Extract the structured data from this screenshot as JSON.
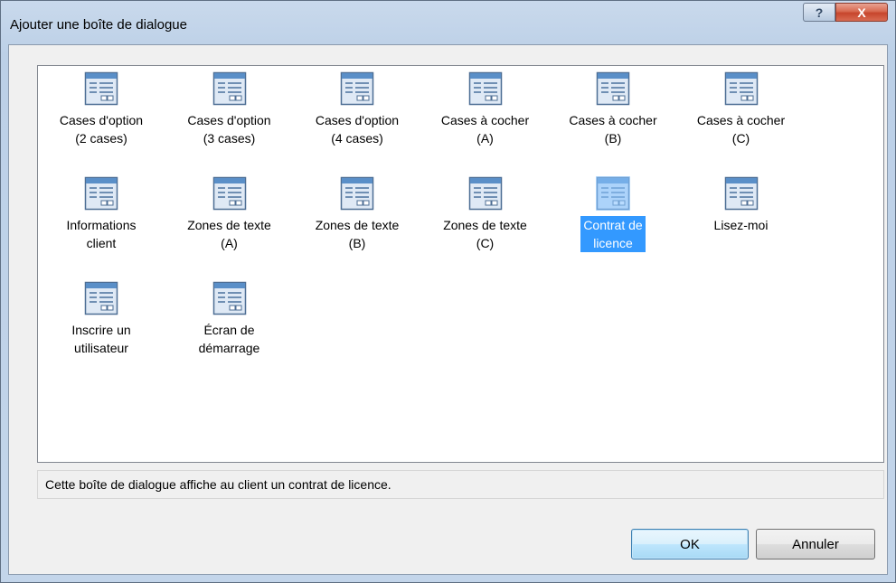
{
  "window": {
    "title": "Ajouter une boîte de dialogue",
    "help_label": "?",
    "close_label": "X"
  },
  "templates": [
    {
      "label": "Cases d'option\n(2 cases)",
      "name": "template-cases-option-2",
      "selected": false
    },
    {
      "label": "Cases d'option\n(3 cases)",
      "name": "template-cases-option-3",
      "selected": false
    },
    {
      "label": "Cases d'option\n(4 cases)",
      "name": "template-cases-option-4",
      "selected": false
    },
    {
      "label": "Cases à cocher\n(A)",
      "name": "template-cases-cocher-a",
      "selected": false
    },
    {
      "label": "Cases à cocher\n(B)",
      "name": "template-cases-cocher-b",
      "selected": false
    },
    {
      "label": "Cases à cocher\n(C)",
      "name": "template-cases-cocher-c",
      "selected": false
    },
    {
      "label": "Informations\nclient",
      "name": "template-informations-client",
      "selected": false
    },
    {
      "label": "Zones de texte\n(A)",
      "name": "template-zones-texte-a",
      "selected": false
    },
    {
      "label": "Zones de texte\n(B)",
      "name": "template-zones-texte-b",
      "selected": false
    },
    {
      "label": "Zones de texte\n(C)",
      "name": "template-zones-texte-c",
      "selected": false
    },
    {
      "label": "Contrat de\nlicence",
      "name": "template-contrat-licence",
      "selected": true
    },
    {
      "label": "Lisez-moi",
      "name": "template-lisez-moi",
      "selected": false
    },
    {
      "label": "Inscrire un\nutilisateur",
      "name": "template-inscrire-utilisateur",
      "selected": false
    },
    {
      "label": "Écran de\ndémarrage",
      "name": "template-ecran-demarrage",
      "selected": false
    }
  ],
  "description": "Cette boîte de dialogue affiche au client un contrat de licence.",
  "buttons": {
    "ok": "OK",
    "cancel": "Annuler"
  },
  "colors": {
    "selection": "#3399ff",
    "icon_header": "#5a8fc8",
    "icon_body": "#dfe9f5"
  }
}
